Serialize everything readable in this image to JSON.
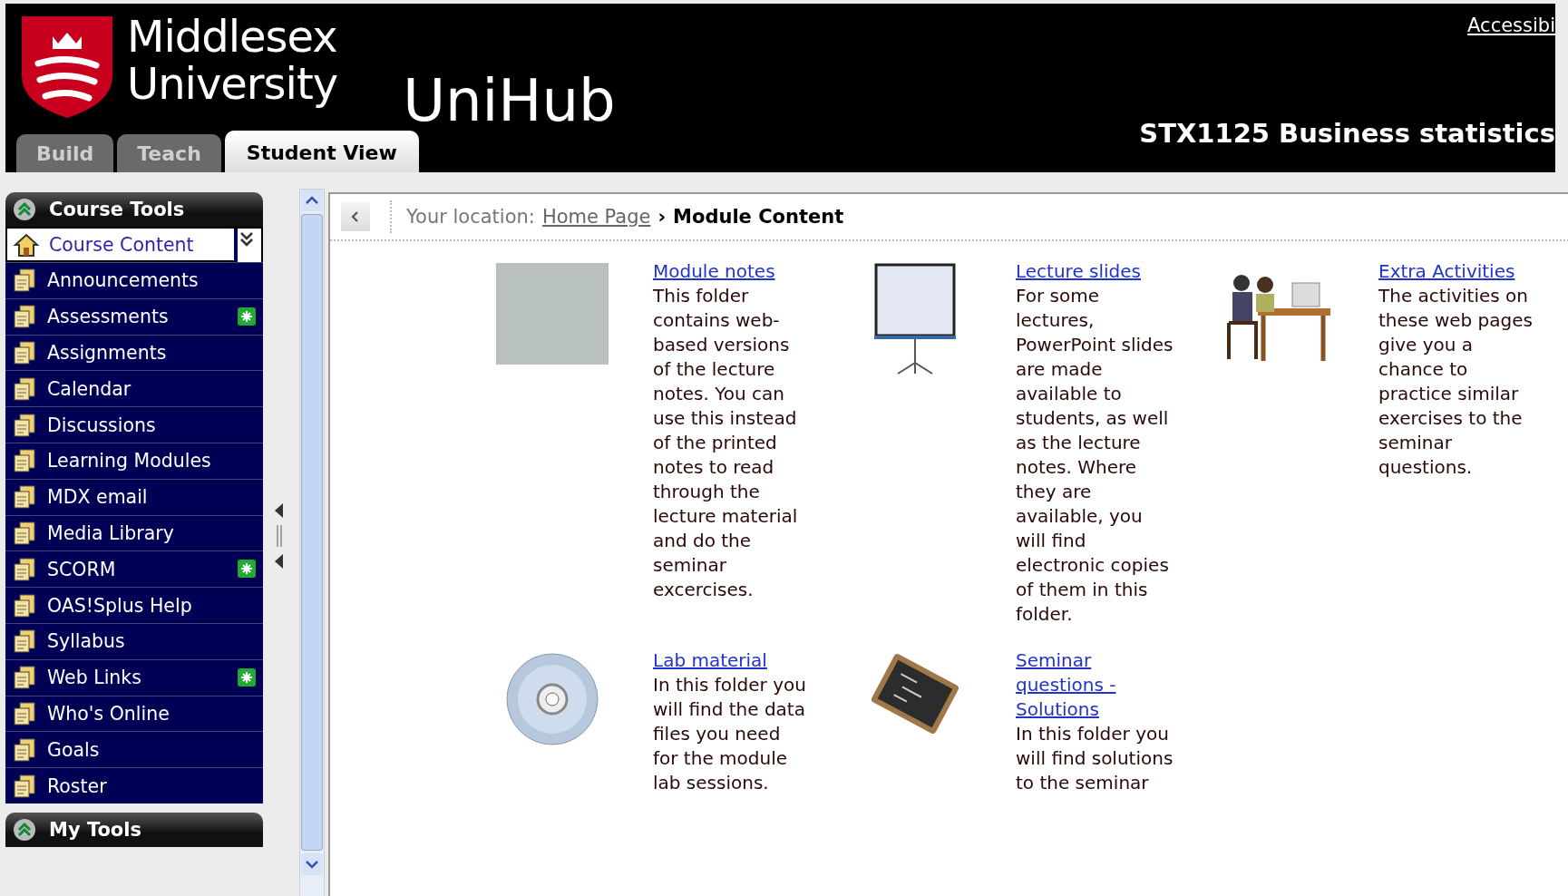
{
  "header": {
    "university": [
      "Middlesex",
      "University"
    ],
    "product": "UniHub",
    "accessibility_link": "Accessibi",
    "course_title": "STX1125 Business statistics"
  },
  "tabs": [
    {
      "label": "Build",
      "selected": false
    },
    {
      "label": "Teach",
      "selected": false
    },
    {
      "label": "Student View",
      "selected": true
    }
  ],
  "sidebar": {
    "title": "Course Tools",
    "items": [
      {
        "label": "Course Content",
        "selected": true,
        "new": false
      },
      {
        "label": "Announcements",
        "selected": false,
        "new": false
      },
      {
        "label": "Assessments",
        "selected": false,
        "new": true
      },
      {
        "label": "Assignments",
        "selected": false,
        "new": false
      },
      {
        "label": "Calendar",
        "selected": false,
        "new": false
      },
      {
        "label": "Discussions",
        "selected": false,
        "new": false
      },
      {
        "label": "Learning Modules",
        "selected": false,
        "new": false
      },
      {
        "label": "MDX email",
        "selected": false,
        "new": false
      },
      {
        "label": "Media Library",
        "selected": false,
        "new": false
      },
      {
        "label": "SCORM",
        "selected": false,
        "new": true
      },
      {
        "label": "OAS!Splus Help",
        "selected": false,
        "new": false
      },
      {
        "label": "Syllabus",
        "selected": false,
        "new": false
      },
      {
        "label": "Web Links",
        "selected": false,
        "new": true
      },
      {
        "label": "Who's Online",
        "selected": false,
        "new": false
      },
      {
        "label": "Goals",
        "selected": false,
        "new": false
      },
      {
        "label": "Roster",
        "selected": false,
        "new": false
      }
    ],
    "second_title": "My Tools"
  },
  "breadcrumb": {
    "prefix": "Your location:",
    "link": "Home Page",
    "separator": "›",
    "current": "Module Content"
  },
  "folders": [
    {
      "kind": "photo",
      "title": "Module notes",
      "description": "This folder contains web-based versions of the lecture notes. You can use this instead of the printed notes to read through the lecture material and do the seminar excercises."
    },
    {
      "kind": "screen",
      "title": "Lecture slides",
      "description": "For some lectures, PowerPoint slides are made available to students, as well as the lecture notes. Where they are available, you will find electronic copies of them in this folder."
    },
    {
      "kind": "people",
      "title": "Extra Activities",
      "description": "The activities on these web pages give you a chance to practice similar exercises to the seminar questions."
    },
    {
      "kind": "disc",
      "title": "Lab material",
      "description": "In this folder you will find the data files you need for the module lab sessions."
    },
    {
      "kind": "slate",
      "title": "Seminar questions - Solutions",
      "description": "In this folder you will find solutions to the seminar"
    }
  ]
}
